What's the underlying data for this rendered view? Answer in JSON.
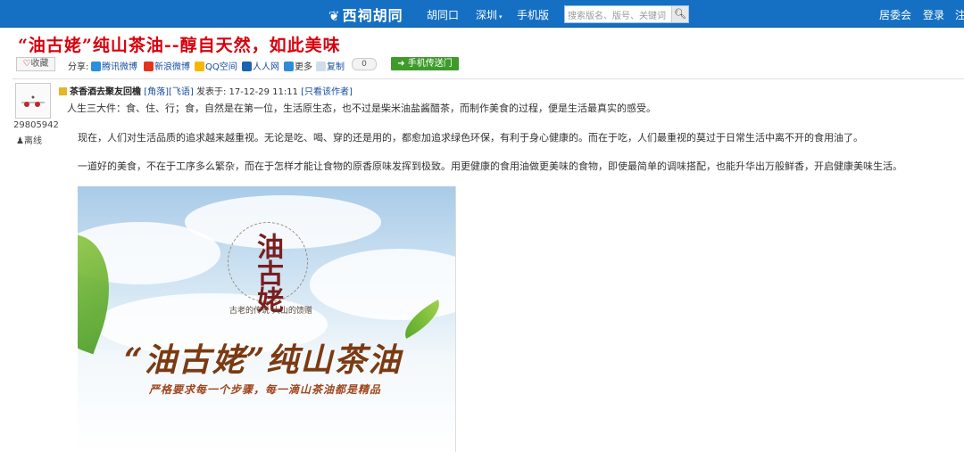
{
  "header": {
    "logo": "西祠胡同",
    "nav": [
      "胡同口",
      "深圳",
      "手机版"
    ],
    "search_placeholder": "搜索版名、版号、关键词",
    "right_links": [
      "居委会",
      "登录",
      "注"
    ]
  },
  "article": {
    "title": "“油古姥”纯山茶油--醇自天然，如此美味"
  },
  "share": {
    "fav_label": "收藏",
    "label": "分享:",
    "items": [
      "腾讯微博",
      "新浪微博",
      "QQ空间",
      "人人网",
      "更多",
      "复制"
    ],
    "count": "0",
    "phone_button": "手机传送门"
  },
  "user": {
    "id": "29805942",
    "status": "离线"
  },
  "post": {
    "author": "茶香酒去聚友回檐",
    "tag1": "[角落]",
    "tag2": "[飞语]",
    "posted": "发表于: 17-12-29 11:11",
    "only_author": "[只看该作者]",
    "paragraphs": [
      "人生三大件：食、住、行；食，自然是在第一位，生活原生态，也不过是柴米油盐酱醋茶，而制作美食的过程，便是生活最真实的感受。",
      "现在，人们对生活品质的追求越来越重视。无论是吃、喝、穿的还是用的，都愈加追求绿色环保，有利于身心健康的。而在于吃，人们最重视的莫过于日常生活中离不开的食用油了。",
      "一道好的美食，不在于工序多么繁杂，而在于怎样才能让食物的原香原味发挥到极致。用更健康的食用油做更美味的食物，即使最简单的调味搭配，也能升华出万般鲜香，开启健康美味生活。"
    ]
  },
  "banner": {
    "emblem_text": "油古姥",
    "tagline": "古老的传说  大山的馈赠",
    "brand": "“油古姥”纯山茶油",
    "slogan": "严格要求每一个步骤，每一滴山茶油都是精品"
  },
  "colors": {
    "topbar": "#1570c4",
    "title": "#d8000c",
    "link": "#1a4fa0",
    "phone_button": "#3d9b2a"
  }
}
